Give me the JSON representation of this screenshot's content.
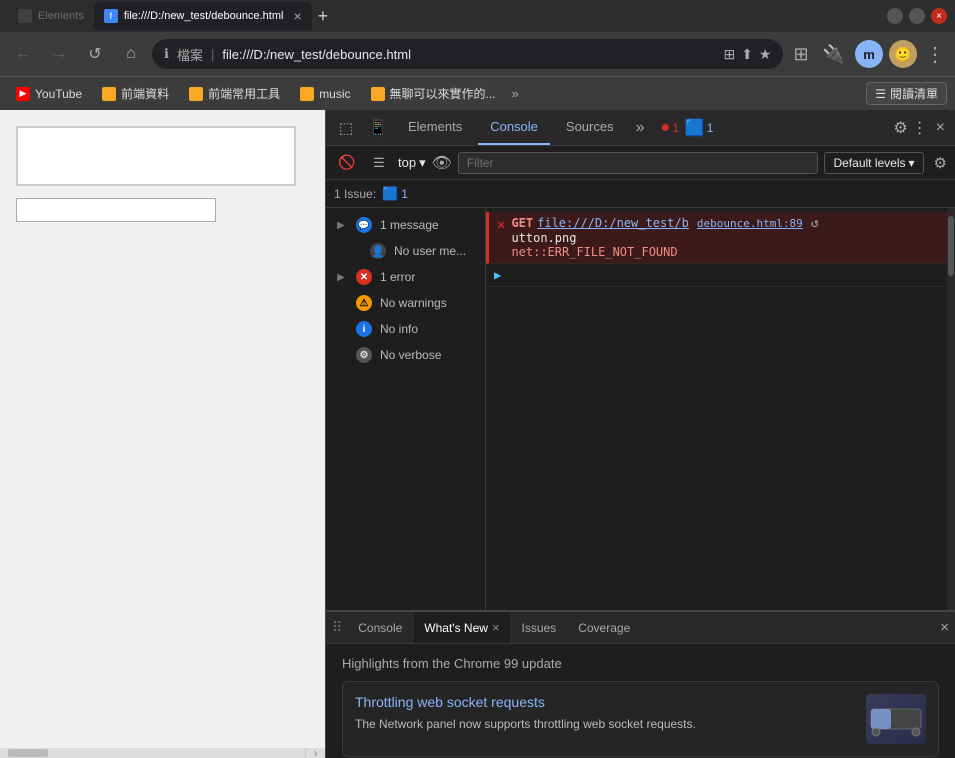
{
  "browser": {
    "title_bar": {
      "tab_label": "file:///D:/new_test/debounce.html",
      "close_label": "×",
      "new_tab_label": "+"
    },
    "nav": {
      "back_label": "←",
      "forward_label": "→",
      "refresh_label": "↺",
      "home_label": "⌂",
      "address_file_label": "檔案",
      "address_url": "file:///D:/new_test/debounce.html",
      "extensions_label": "⊞",
      "profile_label": "m",
      "menu_label": "⋮"
    },
    "bookmarks": [
      {
        "id": "yt",
        "color": "red",
        "label": "YouTube"
      },
      {
        "id": "bk1",
        "color": "#f9a825",
        "label": "前端資料"
      },
      {
        "id": "bk2",
        "color": "#f9a825",
        "label": "前端常用工具"
      },
      {
        "id": "bk3",
        "color": "#f9a825",
        "label": "music"
      },
      {
        "id": "bk4",
        "color": "#f9a825",
        "label": "無聊可以來實作的..."
      }
    ],
    "bookmarks_more": "»",
    "reading_list": "閱讀清單"
  },
  "devtools": {
    "toolbar": {
      "tabs": [
        {
          "id": "elements",
          "label": "Elements",
          "active": false
        },
        {
          "id": "console",
          "label": "Console",
          "active": true
        },
        {
          "id": "sources",
          "label": "Sources",
          "active": false
        }
      ],
      "more_tabs_label": "»",
      "error_badge": "1",
      "info_badge": "1",
      "settings_label": "⚙",
      "more_label": "⋮",
      "close_label": "×"
    },
    "console_toolbar": {
      "clear_label": "🚫",
      "top_label": "top",
      "top_arrow": "▾",
      "eye_label": "👁",
      "filter_placeholder": "Filter",
      "default_levels": "Default levels",
      "down_arrow": "▾",
      "gear_label": "⚙"
    },
    "issues_bar": {
      "label": "1 Issue:",
      "badge_icon": "🟦",
      "badge_count": "1"
    },
    "sidebar": {
      "items": [
        {
          "id": "messages",
          "expand": "▶",
          "icon": "msg",
          "icon_type": "blue",
          "label": "1 message"
        },
        {
          "id": "user-messages",
          "expand": "",
          "icon": "👤",
          "icon_type": "user",
          "label": "No user me..."
        },
        {
          "id": "errors",
          "expand": "▶",
          "icon": "✕",
          "icon_type": "red",
          "label": "1 error"
        },
        {
          "id": "warnings",
          "expand": "",
          "icon": "⚠",
          "icon_type": "yellow",
          "label": "No warnings"
        },
        {
          "id": "info",
          "expand": "",
          "icon": "ℹ",
          "icon_type": "info",
          "label": "No info"
        },
        {
          "id": "verbose",
          "expand": "",
          "icon": "⚙",
          "icon_type": "gear",
          "label": "No verbose"
        }
      ]
    },
    "console_output": {
      "entries": [
        {
          "type": "error",
          "get_label": "GET",
          "url_part1": "file:///D:/new_test/b",
          "url_part2": "debounce.html:89",
          "url_suffix": "utton.png",
          "error_text": "net::ERR_FILE_NOT_FOUND"
        }
      ],
      "expand_arrow": "▶"
    },
    "bottom_panel": {
      "drag_label": "⠿",
      "tabs": [
        {
          "id": "console-bt",
          "label": "Console",
          "active": false,
          "closeable": false
        },
        {
          "id": "whats-new",
          "label": "What's New",
          "active": true,
          "closeable": true
        },
        {
          "id": "issues",
          "label": "Issues",
          "active": false,
          "closeable": false
        },
        {
          "id": "coverage",
          "label": "Coverage",
          "active": false,
          "closeable": false
        }
      ],
      "close_label": "×",
      "whats_new": {
        "title": "Highlights from the Chrome 99 update",
        "card": {
          "heading": "Throttling web socket requests",
          "description": "The Network panel now supports throttling web socket requests."
        }
      }
    }
  }
}
